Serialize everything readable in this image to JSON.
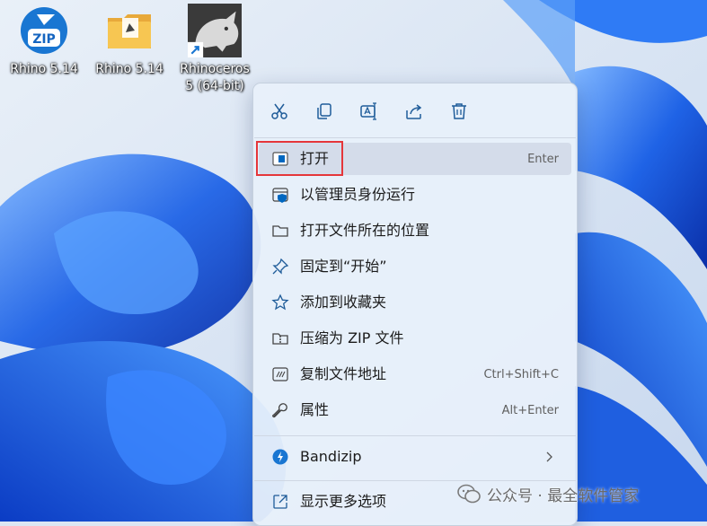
{
  "desktop": {
    "icons": [
      {
        "label": "Rhino 5.14",
        "icon": "zip-archive-icon"
      },
      {
        "label": "Rhino 5.14",
        "icon": "folder-icon"
      },
      {
        "label": "Rhinoceros 5 (64-bit)",
        "line1": "Rhinoceros",
        "line2": "5 (64-bit)",
        "icon": "rhino-shortcut-icon"
      }
    ]
  },
  "context_menu": {
    "toolbar": [
      {
        "icon": "cut-icon"
      },
      {
        "icon": "copy-icon"
      },
      {
        "icon": "rename-icon"
      },
      {
        "icon": "share-icon"
      },
      {
        "icon": "delete-icon"
      }
    ],
    "items": [
      {
        "label": "打开",
        "shortcut": "Enter",
        "icon": "open-icon"
      },
      {
        "label": "以管理员身份运行",
        "shortcut": "",
        "icon": "run-as-admin-icon"
      },
      {
        "label": "打开文件所在的位置",
        "shortcut": "",
        "icon": "folder-icon"
      },
      {
        "label": "固定到“开始”",
        "shortcut": "",
        "icon": "pin-icon"
      },
      {
        "label": "添加到收藏夹",
        "shortcut": "",
        "icon": "star-icon"
      },
      {
        "label": "压缩为 ZIP 文件",
        "shortcut": "",
        "icon": "zip-icon"
      },
      {
        "label": "复制文件地址",
        "shortcut": "Ctrl+Shift+C",
        "icon": "copy-path-icon"
      },
      {
        "label": "属性",
        "shortcut": "Alt+Enter",
        "icon": "properties-icon"
      },
      {
        "label": "Bandizip",
        "shortcut": "",
        "icon": "bandizip-icon"
      },
      {
        "label": "显示更多选项",
        "shortcut": "",
        "icon": "more-options-icon"
      }
    ]
  },
  "watermark": {
    "text": "公众号 · 最全软件管家"
  },
  "colors": {
    "highlight_border": "#e5363a",
    "accent": "#0067c0",
    "wallpaper_blue": "#1f5fe0"
  }
}
